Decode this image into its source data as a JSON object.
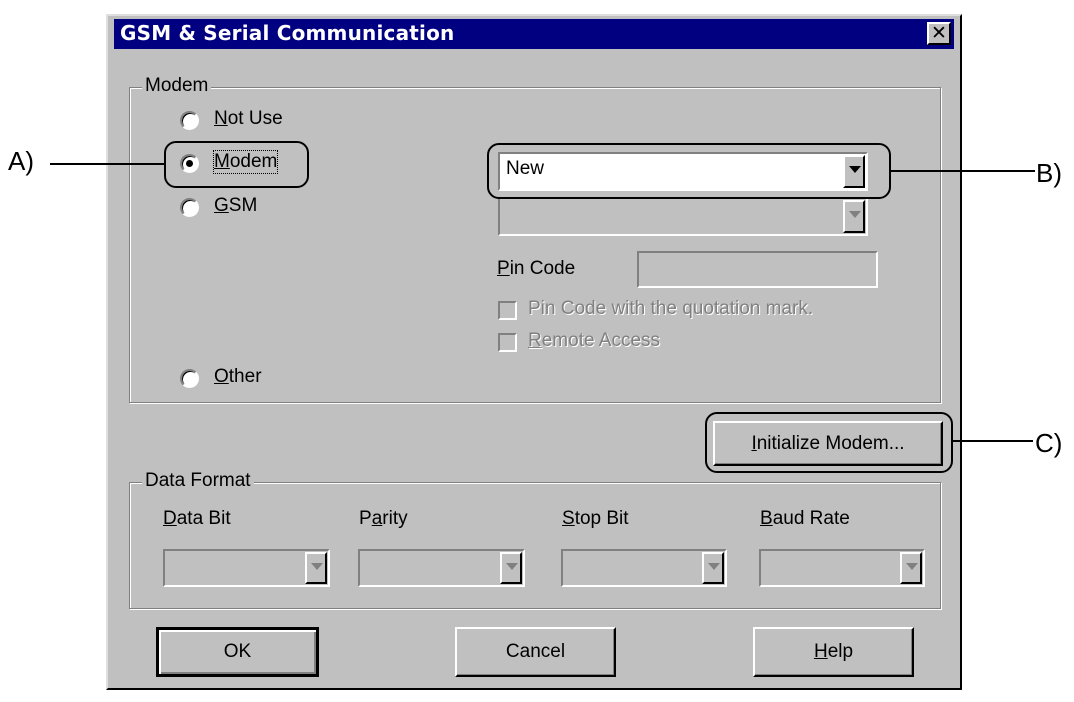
{
  "window": {
    "title": "GSM & Serial Communication",
    "close_glyph": "✕"
  },
  "modem_group": {
    "label": "Modem",
    "options": [
      {
        "label": "Not Use",
        "key": "N",
        "rest": "ot Use",
        "selected": false
      },
      {
        "label": "Modem",
        "key": "M",
        "rest": "odem",
        "selected": true
      },
      {
        "label": "GSM",
        "key": "G",
        "rest": "SM",
        "selected": false
      },
      {
        "label": "Other",
        "key": "O",
        "rest": "ther",
        "selected": false
      }
    ],
    "modem_select_value": "New",
    "gsm_select_value": "",
    "pin_code_label": "Pin Code",
    "pin_code_key": "P",
    "pin_code_rest": "in Code",
    "pin_code_value": "",
    "pin_quote_checkbox": "Pin Code with the quotation mark.",
    "remote_access_key": "R",
    "remote_access_rest": "emote Access"
  },
  "initialize_button": {
    "key": "I",
    "rest": "nitialize Modem..."
  },
  "data_format": {
    "label": "Data Format",
    "fields": [
      {
        "label": "Data Bit",
        "key": "D",
        "rest": "ata Bit",
        "value": ""
      },
      {
        "label": "Parity",
        "pre": "P",
        "key": "a",
        "rest": "rity",
        "value": ""
      },
      {
        "label": "Stop Bit",
        "key": "S",
        "rest": "top Bit",
        "value": ""
      },
      {
        "label": "Baud Rate",
        "key": "B",
        "rest": "aud Rate",
        "value": ""
      }
    ]
  },
  "buttons": {
    "ok": "OK",
    "cancel": "Cancel",
    "help_key": "H",
    "help_rest": "elp"
  },
  "annotations": {
    "a": "A)",
    "b": "B)",
    "c": "C)"
  },
  "colors": {
    "titlebar": "#000080",
    "face": "#c0c0c0",
    "disabled_text": "#808080"
  }
}
